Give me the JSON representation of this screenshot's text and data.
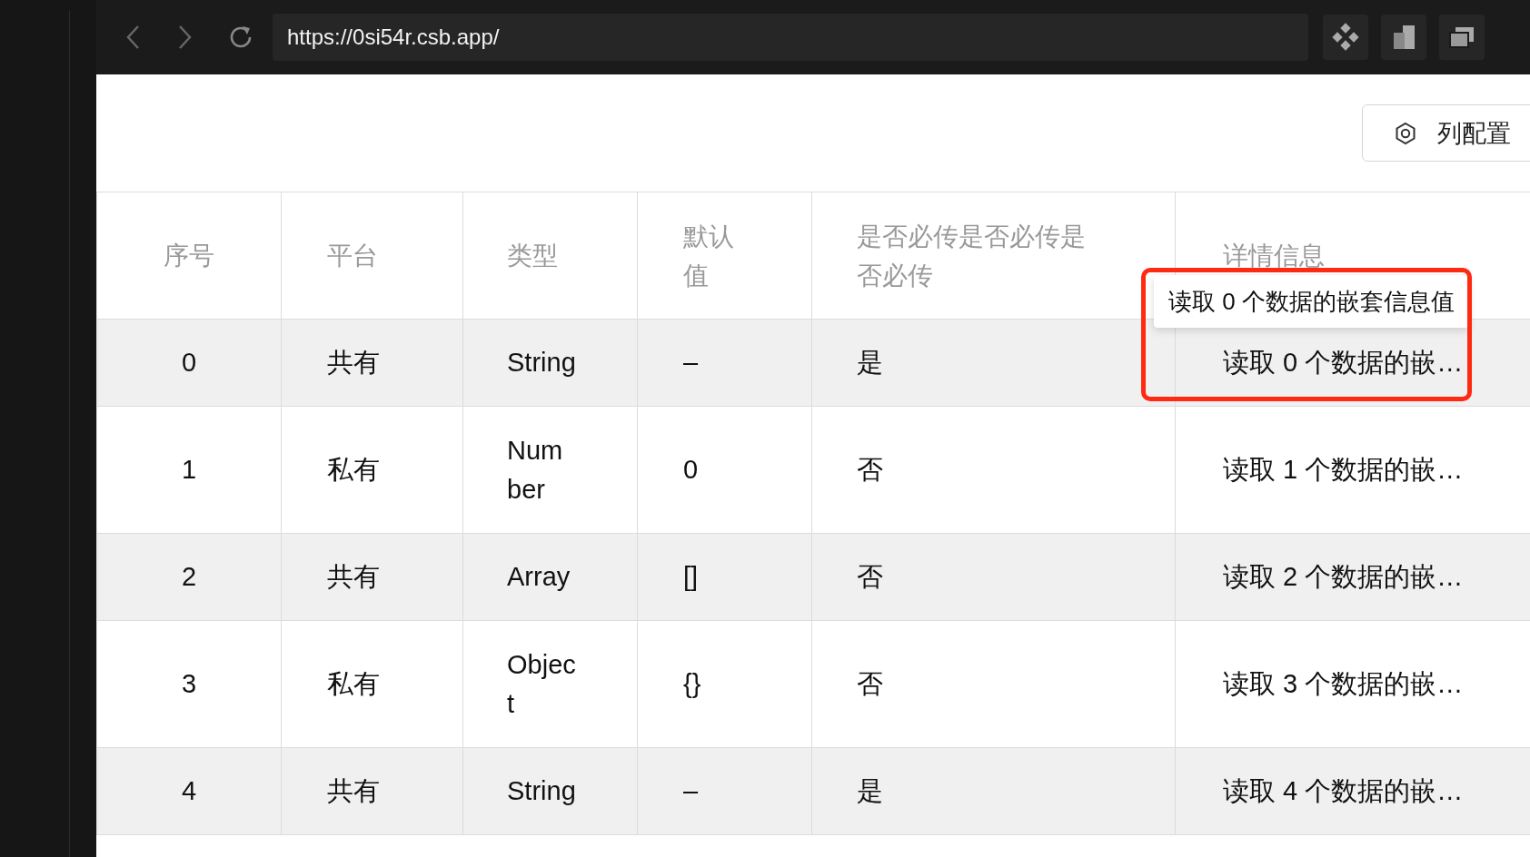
{
  "browser": {
    "url": "https://0si54r.csb.app/"
  },
  "toolbar": {
    "column_settings_button": "列配置"
  },
  "table": {
    "columns": [
      "序号",
      "平台",
      "类型",
      "默认值",
      "是否必传是否必传是否必传",
      "详情信息"
    ],
    "rows": [
      {
        "index": "0",
        "platform": "共有",
        "type": "String",
        "default": "–",
        "required": "是",
        "detail": "读取 0 个数据的嵌…"
      },
      {
        "index": "1",
        "platform": "私有",
        "type": "Number",
        "default": "0",
        "required": "否",
        "detail": "读取 1 个数据的嵌…"
      },
      {
        "index": "2",
        "platform": "共有",
        "type": "Array",
        "default": "[]",
        "required": "否",
        "detail": "读取 2 个数据的嵌…"
      },
      {
        "index": "3",
        "platform": "私有",
        "type": "Object",
        "default": "{}",
        "required": "否",
        "detail": "读取 3 个数据的嵌…"
      },
      {
        "index": "4",
        "platform": "共有",
        "type": "String",
        "default": "–",
        "required": "是",
        "detail": "读取 4 个数据的嵌…"
      }
    ]
  },
  "tooltip": {
    "text": "读取 0 个数据的嵌套信息值"
  }
}
